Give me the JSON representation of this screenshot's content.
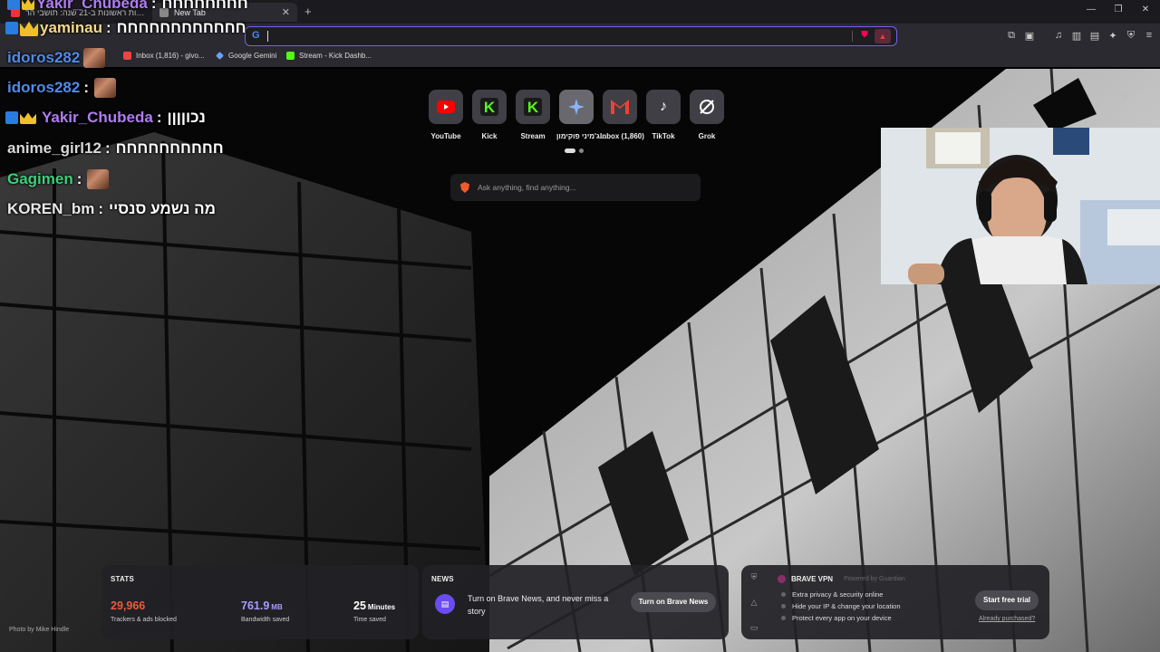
{
  "tabs": [
    {
      "title": "בחירות ראשונות ב-21 שנה: תושבי הר..."
    },
    {
      "title": "New Tab"
    }
  ],
  "bookmarks": [
    {
      "label": "Inbox (1,816) - givo..."
    },
    {
      "label": "Google Gemini"
    },
    {
      "label": "Stream - Kick Dashb..."
    }
  ],
  "chat": {
    "lines": [
      {
        "user": "Yakir_Chubeda",
        "message": "חחחחחחחח",
        "color": "#b07cf2",
        "badges": [
          "mod",
          "crown"
        ]
      },
      {
        "user": "yaminau",
        "message": "חחחחחחחחחחחח",
        "color": "#f5d98a",
        "badges": [
          "mod",
          "crown"
        ]
      },
      {
        "user": "idoros282",
        "message": "",
        "color": "#4f8be8",
        "badges": [],
        "emote": true
      },
      {
        "user": "idoros282",
        "message": "",
        "color": "#4f8be8",
        "badges": [],
        "emote": true
      },
      {
        "user": "Yakir_Chubeda",
        "message": "נכוןןןן",
        "color": "#b07cf2",
        "badges": [
          "mod",
          "crown"
        ]
      },
      {
        "user": "anime_girl12",
        "message": "חחחחחחחחחח",
        "color": "#d8d8d8",
        "badges": []
      },
      {
        "user": "Gagimen",
        "message": "",
        "color": "#3ecf7a",
        "badges": [],
        "emote": true
      },
      {
        "user": "KOREN_bm",
        "message": "מה נשמע סנסיי",
        "color": "#e8e8e8",
        "badges": []
      }
    ],
    "colon": ":"
  },
  "top_sites": [
    {
      "label": "YouTube"
    },
    {
      "label": "Kick"
    },
    {
      "label": "Stream"
    },
    {
      "label": "ג'מיני פוקימון..."
    },
    {
      "label": "Inbox (1,860)"
    },
    {
      "label": "TikTok"
    },
    {
      "label": "Grok"
    }
  ],
  "search": {
    "placeholder": "Ask anything, find anything..."
  },
  "stats": {
    "title": "STATS",
    "trackers": {
      "value": "29,966",
      "desc": "Trackers & ads blocked",
      "color": "#f05a3a"
    },
    "bandwidth": {
      "value": "761.9",
      "unit": "MB",
      "desc": "Bandwidth saved",
      "color": "#a99bff"
    },
    "time": {
      "value": "25",
      "unit": "Minutes",
      "desc": "Time saved",
      "color": "#ffffff"
    }
  },
  "news": {
    "title": "NEWS",
    "text": "Turn on Brave News, and never miss a story",
    "button": "Turn on Brave News"
  },
  "vpn": {
    "title": "BRAVE VPN",
    "powered": "Powered by Guardian",
    "features": [
      "Extra privacy & security online",
      "Hide your IP & change your location",
      "Protect every app on your device"
    ],
    "button": "Start free trial",
    "link": "Already purchased?"
  },
  "photo_credit": "Photo by Mike Hindle"
}
